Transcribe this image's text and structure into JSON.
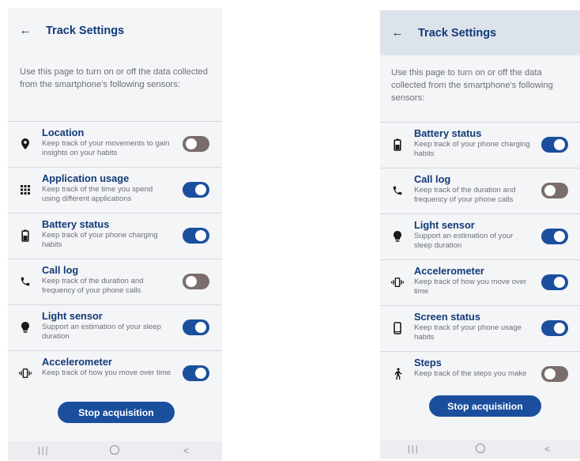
{
  "screens": [
    {
      "title": "Track Settings",
      "intro": "Use this page to turn on or off the data collected from the smartphone's following sensors:",
      "items": [
        {
          "icon": "location-pin-icon",
          "title": "Location",
          "desc": "Keep track of your movements to gain insights on your habits",
          "on": false
        },
        {
          "icon": "app-grid-icon",
          "title": "Application usage",
          "desc": "Keep track of the time you spend using different applications",
          "on": true
        },
        {
          "icon": "battery-icon",
          "title": "Battery status",
          "desc": "Keep track of your phone charging habits",
          "on": true
        },
        {
          "icon": "phone-call-icon",
          "title": "Call log",
          "desc": "Keep track of the duration and frequency of your phone calls",
          "on": false
        },
        {
          "icon": "light-bulb-icon",
          "title": "Light sensor",
          "desc": "Support an estimation of your sleep duration",
          "on": true
        },
        {
          "icon": "vibration-icon",
          "title": "Accelerometer",
          "desc": "Keep track of how you move over time",
          "on": true
        }
      ],
      "button": "Stop acquisition",
      "nav": {
        "recent": "|||",
        "home": "",
        "back": "<"
      }
    },
    {
      "title": "Track Settings",
      "intro": "Use this page to turn on or off the data collected from the smartphone's following sensors:",
      "items": [
        {
          "icon": "battery-icon",
          "title": "Battery status",
          "desc": "Keep track of your phone charging habits",
          "on": true
        },
        {
          "icon": "phone-call-icon",
          "title": "Call log",
          "desc": "Keep track of the duration and frequency of your phone calls",
          "on": false
        },
        {
          "icon": "light-bulb-icon",
          "title": "Light sensor",
          "desc": "Support an estimation of your sleep duration",
          "on": true
        },
        {
          "icon": "vibration-icon",
          "title": "Accelerometer",
          "desc": "Keep track of how you move over time",
          "on": true
        },
        {
          "icon": "smartphone-icon",
          "title": "Screen status",
          "desc": "Keep track of your phone usage habits",
          "on": true
        },
        {
          "icon": "walking-person-icon",
          "title": "Steps",
          "desc": "Keep track of the steps you make",
          "on": false
        }
      ],
      "button": "Stop acquisition",
      "nav": {
        "recent": "|||",
        "home": "",
        "back": "<"
      }
    }
  ],
  "colors": {
    "accent": "#1b4f9e",
    "title": "#123a78",
    "toggle_off": "#7a6d6b"
  }
}
